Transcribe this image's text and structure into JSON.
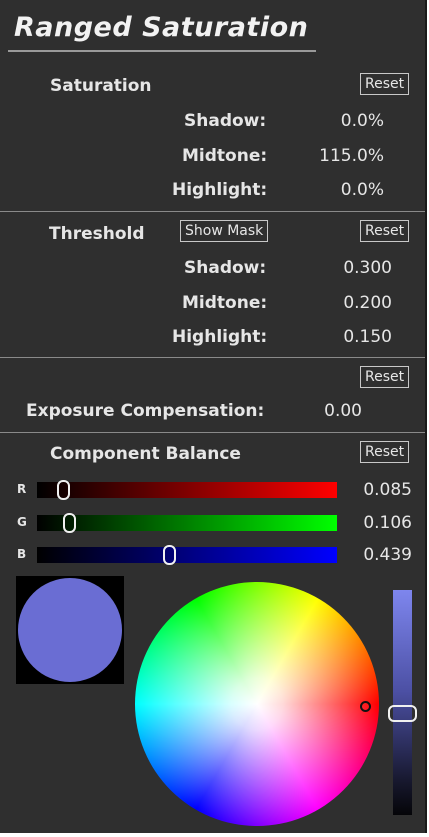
{
  "title": "Ranged Saturation",
  "saturation": {
    "label": "Saturation",
    "reset_label": "Reset",
    "rows": [
      {
        "label": "Shadow:",
        "value": "0.0%"
      },
      {
        "label": "Midtone:",
        "value": "115.0%"
      },
      {
        "label": "Highlight:",
        "value": "0.0%"
      }
    ]
  },
  "threshold": {
    "label": "Threshold",
    "show_mask_label": "Show Mask",
    "reset_label": "Reset",
    "rows": [
      {
        "label": "Shadow:",
        "value": "0.300"
      },
      {
        "label": "Midtone:",
        "value": "0.200"
      },
      {
        "label": "Highlight:",
        "value": "0.150"
      }
    ]
  },
  "exposure": {
    "reset_label": "Reset",
    "label": "Exposure Compensation:",
    "value": "0.00"
  },
  "component_balance": {
    "label": "Component Balance",
    "reset_label": "Reset",
    "channels": [
      {
        "name": "R",
        "value": "0.085",
        "level": 0.085,
        "color": "#ff0000"
      },
      {
        "name": "G",
        "value": "0.106",
        "level": 0.106,
        "color": "#00ff00"
      },
      {
        "name": "B",
        "value": "0.439",
        "level": 0.439,
        "color": "#0000ff"
      }
    ],
    "preview_color": "#6a6dd3",
    "brightness_level": 0.55
  }
}
